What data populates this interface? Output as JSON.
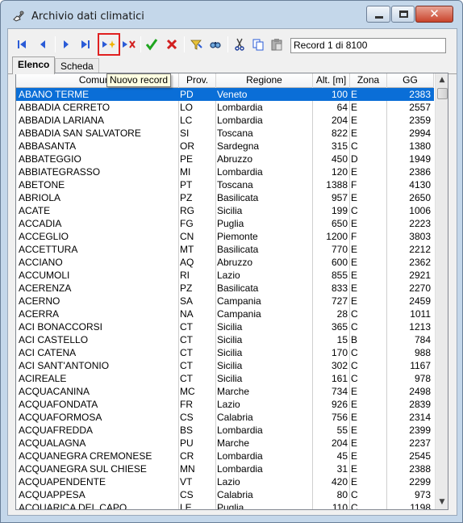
{
  "window": {
    "title": "Archivio dati climatici",
    "close_glyph": "✕"
  },
  "toolbar": {
    "record_indicator": "Record 1 di 8100",
    "icons": [
      "first-record-icon",
      "previous-record-icon",
      "next-record-icon",
      "last-record-icon",
      "new-record-icon",
      "delete-record-icon",
      "confirm-icon",
      "cancel-icon",
      "filter-icon",
      "search-icon",
      "cut-icon",
      "copy-icon",
      "paste-icon"
    ],
    "colors": {
      "nav_blue": "#2a5bd7",
      "confirm_green": "#1ea51e",
      "cancel_red": "#d21f1f",
      "highlight_red": "#e02020"
    }
  },
  "tooltip": {
    "text": "Nuovo record"
  },
  "tabs": [
    {
      "label": "Elenco",
      "active": true
    },
    {
      "label": "Scheda",
      "active": false
    }
  ],
  "grid": {
    "headers": [
      "Comune",
      "Prov.",
      "Regione",
      "Alt. [m]",
      "Zona",
      "GG"
    ],
    "selected_row_color": "#0a6ed7",
    "rows": [
      [
        "ABANO TERME",
        "PD",
        "Veneto",
        "100",
        "E",
        "2383"
      ],
      [
        "ABBADIA CERRETO",
        "LO",
        "Lombardia",
        "64",
        "E",
        "2557"
      ],
      [
        "ABBADIA LARIANA",
        "LC",
        "Lombardia",
        "204",
        "E",
        "2359"
      ],
      [
        "ABBADIA SAN SALVATORE",
        "SI",
        "Toscana",
        "822",
        "E",
        "2994"
      ],
      [
        "ABBASANTA",
        "OR",
        "Sardegna",
        "315",
        "C",
        "1380"
      ],
      [
        "ABBATEGGIO",
        "PE",
        "Abruzzo",
        "450",
        "D",
        "1949"
      ],
      [
        "ABBIATEGRASSO",
        "MI",
        "Lombardia",
        "120",
        "E",
        "2386"
      ],
      [
        "ABETONE",
        "PT",
        "Toscana",
        "1388",
        "F",
        "4130"
      ],
      [
        "ABRIOLA",
        "PZ",
        "Basilicata",
        "957",
        "E",
        "2650"
      ],
      [
        "ACATE",
        "RG",
        "Sicilia",
        "199",
        "C",
        "1006"
      ],
      [
        "ACCADIA",
        "FG",
        "Puglia",
        "650",
        "E",
        "2223"
      ],
      [
        "ACCEGLIO",
        "CN",
        "Piemonte",
        "1200",
        "F",
        "3803"
      ],
      [
        "ACCETTURA",
        "MT",
        "Basilicata",
        "770",
        "E",
        "2212"
      ],
      [
        "ACCIANO",
        "AQ",
        "Abruzzo",
        "600",
        "E",
        "2362"
      ],
      [
        "ACCUMOLI",
        "RI",
        "Lazio",
        "855",
        "E",
        "2921"
      ],
      [
        "ACERENZA",
        "PZ",
        "Basilicata",
        "833",
        "E",
        "2270"
      ],
      [
        "ACERNO",
        "SA",
        "Campania",
        "727",
        "E",
        "2459"
      ],
      [
        "ACERRA",
        "NA",
        "Campania",
        "28",
        "C",
        "1011"
      ],
      [
        "ACI BONACCORSI",
        "CT",
        "Sicilia",
        "365",
        "C",
        "1213"
      ],
      [
        "ACI CASTELLO",
        "CT",
        "Sicilia",
        "15",
        "B",
        "784"
      ],
      [
        "ACI CATENA",
        "CT",
        "Sicilia",
        "170",
        "C",
        "988"
      ],
      [
        "ACI SANT'ANTONIO",
        "CT",
        "Sicilia",
        "302",
        "C",
        "1167"
      ],
      [
        "ACIREALE",
        "CT",
        "Sicilia",
        "161",
        "C",
        "978"
      ],
      [
        "ACQUACANINA",
        "MC",
        "Marche",
        "734",
        "E",
        "2498"
      ],
      [
        "ACQUAFONDATA",
        "FR",
        "Lazio",
        "926",
        "E",
        "2839"
      ],
      [
        "ACQUAFORMOSA",
        "CS",
        "Calabria",
        "756",
        "E",
        "2314"
      ],
      [
        "ACQUAFREDDA",
        "BS",
        "Lombardia",
        "55",
        "E",
        "2399"
      ],
      [
        "ACQUALAGNA",
        "PU",
        "Marche",
        "204",
        "E",
        "2237"
      ],
      [
        "ACQUANEGRA CREMONESE",
        "CR",
        "Lombardia",
        "45",
        "E",
        "2545"
      ],
      [
        "ACQUANEGRA SUL CHIESE",
        "MN",
        "Lombardia",
        "31",
        "E",
        "2388"
      ],
      [
        "ACQUAPENDENTE",
        "VT",
        "Lazio",
        "420",
        "E",
        "2299"
      ],
      [
        "ACQUAPPESA",
        "CS",
        "Calabria",
        "80",
        "C",
        "973"
      ],
      [
        "ACQUARICA DEL CAPO",
        "LE",
        "Puglia",
        "110",
        "C",
        "1198"
      ]
    ]
  },
  "scrollbar": {
    "up_glyph": "▲",
    "down_glyph": "▼"
  }
}
